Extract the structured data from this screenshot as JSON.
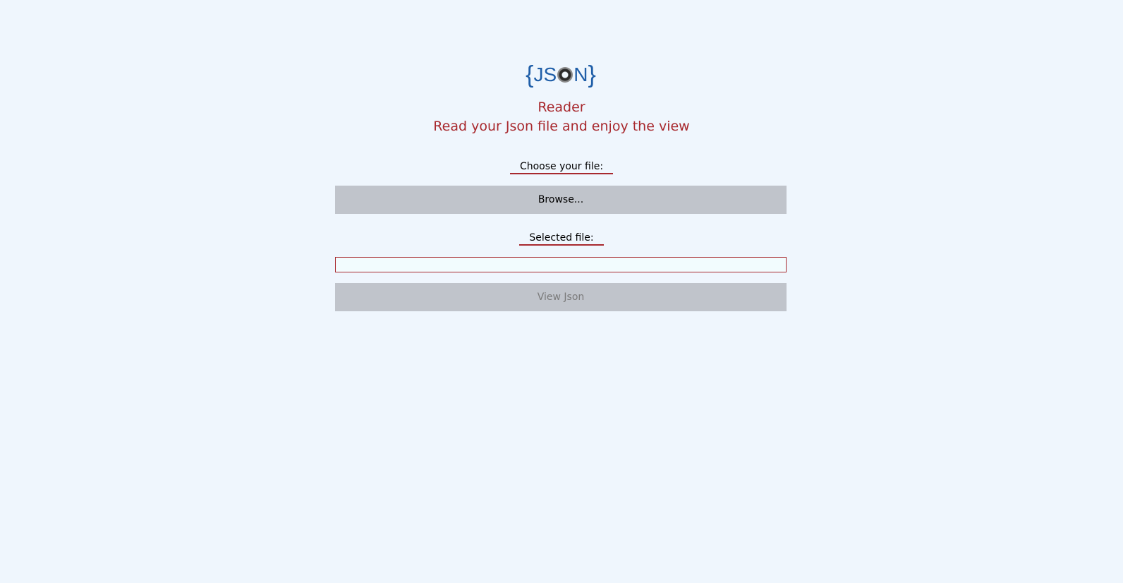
{
  "logo": {
    "open_brace": "{",
    "text_before": "JS",
    "text_after": "N",
    "close_brace": "}",
    "color": "#1f5ea8"
  },
  "header": {
    "title": "Reader",
    "subtitle": "Read your Json file and enjoy the view",
    "color": "#a8292e"
  },
  "file_chooser": {
    "label": "Choose your file:",
    "browse_label": "Browse..."
  },
  "selected_file": {
    "label": "Selected file:",
    "value": "",
    "placeholder": ""
  },
  "actions": {
    "view_label": "View Json"
  },
  "colors": {
    "background": "#eff6fd",
    "button": "#c0c4cb",
    "accent": "#a8292e"
  }
}
